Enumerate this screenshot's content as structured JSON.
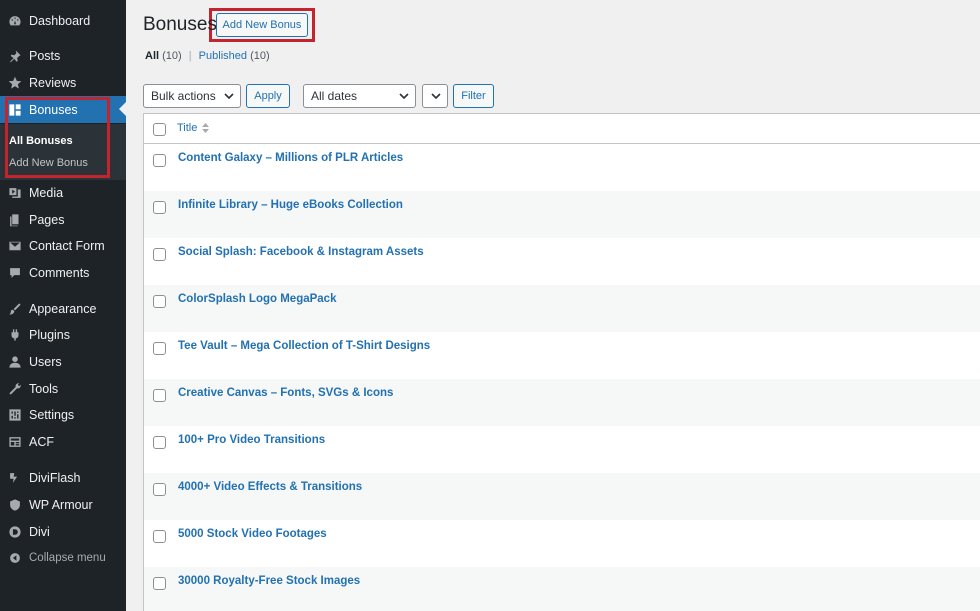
{
  "sidebar": {
    "items": [
      {
        "label": "Dashboard",
        "icon": "dashboard-icon"
      },
      {
        "label": "Posts",
        "icon": "pin-icon"
      },
      {
        "label": "Reviews",
        "icon": "star-icon"
      },
      {
        "label": "Bonuses",
        "icon": "grid-icon"
      },
      {
        "label": "Media",
        "icon": "media-icon"
      },
      {
        "label": "Pages",
        "icon": "pages-icon"
      },
      {
        "label": "Contact Form",
        "icon": "mail-icon"
      },
      {
        "label": "Comments",
        "icon": "comment-icon"
      },
      {
        "label": "Appearance",
        "icon": "brush-icon"
      },
      {
        "label": "Plugins",
        "icon": "plug-icon"
      },
      {
        "label": "Users",
        "icon": "user-icon"
      },
      {
        "label": "Tools",
        "icon": "wrench-icon"
      },
      {
        "label": "Settings",
        "icon": "settings-icon"
      },
      {
        "label": "ACF",
        "icon": "acf-icon"
      },
      {
        "label": "DiviFlash",
        "icon": "flash-icon"
      },
      {
        "label": "WP Armour",
        "icon": "shield-icon"
      },
      {
        "label": "Divi",
        "icon": "divi-icon"
      }
    ],
    "submenu": [
      "All Bonuses",
      "Add New Bonus"
    ],
    "collapse_label": "Collapse menu"
  },
  "header": {
    "title": "Bonuses",
    "add_new_label": "Add New Bonus"
  },
  "filters": {
    "all_label": "All",
    "all_count": "(10)",
    "separator": "|",
    "published_label": "Published",
    "published_count": "(10)"
  },
  "tablenav": {
    "bulk_actions": "Bulk actions",
    "apply": "Apply",
    "dates": "All dates",
    "filter": "Filter"
  },
  "table": {
    "column_title": "Title",
    "rows": [
      "Content Galaxy – Millions of PLR Articles",
      "Infinite Library – Huge eBooks Collection",
      "Social Splash: Facebook & Instagram Assets",
      "ColorSplash Logo MegaPack",
      "Tee Vault – Mega Collection of T-Shirt Designs",
      "Creative Canvas – Fonts, SVGs & Icons",
      "100+ Pro Video Transitions",
      "4000+ Video Effects & Transitions",
      "5000 Stock Video Footages",
      "30000 Royalty-Free Stock Images"
    ]
  },
  "colors": {
    "sidebar_bg": "#1d2327",
    "accent": "#2271b1",
    "annotation_red": "#c2252d"
  }
}
